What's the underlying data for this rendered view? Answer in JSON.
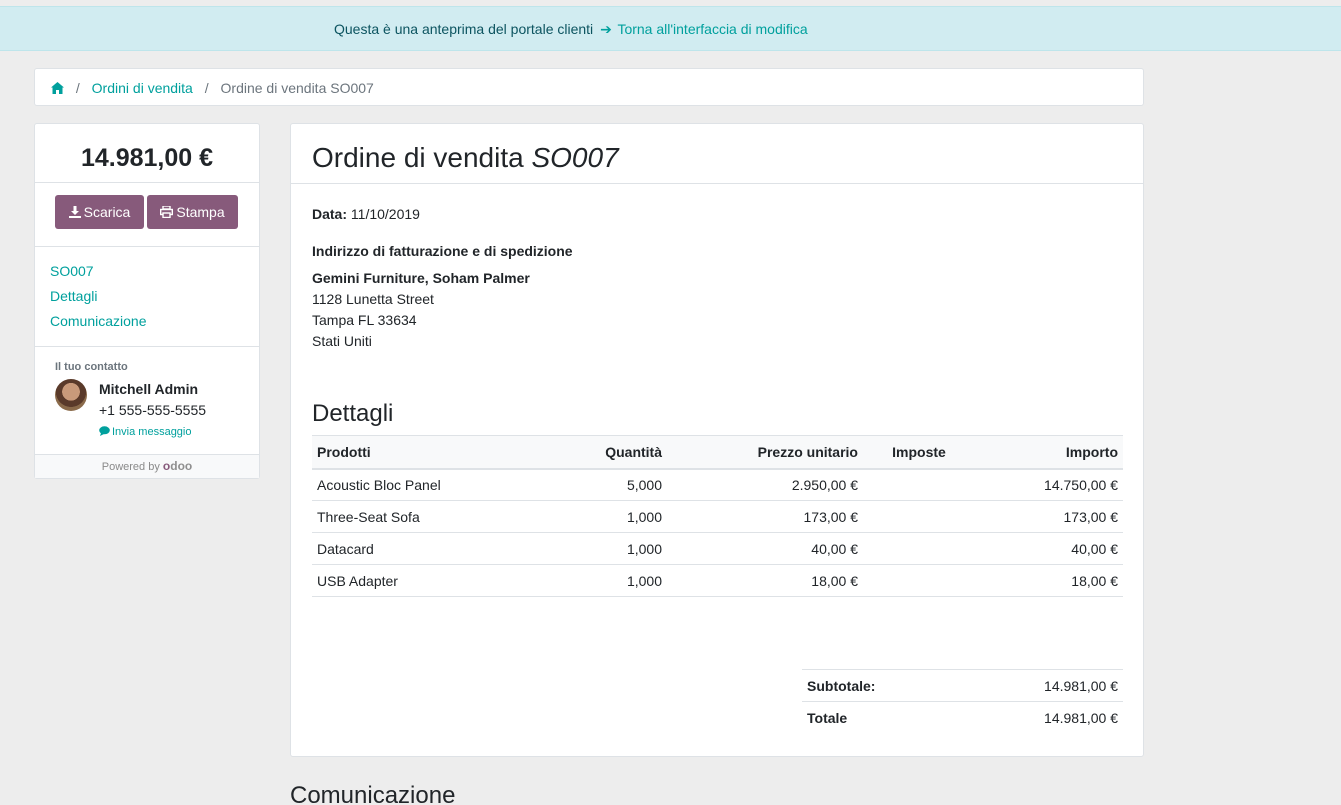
{
  "banner": {
    "text": "Questa è una anteprima del portale clienti",
    "link": "Torna all'interfaccia di modifica"
  },
  "breadcrumb": {
    "home_icon": "home-icon",
    "items": [
      "Ordini di vendita",
      "Ordine di vendita SO007"
    ]
  },
  "sidebar": {
    "amount": "14.981,00 €",
    "download_label": "Scarica",
    "print_label": "Stampa",
    "nav": [
      "SO007",
      "Dettagli",
      "Comunicazione"
    ],
    "contact": {
      "label": "Il tuo contatto",
      "name": "Mitchell Admin",
      "phone": "+1 555-555-5555",
      "message": "Invia messaggio"
    },
    "powered": "Powered by",
    "odoo_logo": "odoo"
  },
  "order": {
    "title_prefix": "Ordine di vendita",
    "title_ref": "SO007",
    "date_label": "Data:",
    "date_value": "11/10/2019",
    "address_title": "Indirizzo di fatturazione e di spedizione",
    "address": {
      "name": "Gemini Furniture, Soham Palmer",
      "street": "1128 Lunetta Street",
      "city": "Tampa FL 33634",
      "country": "Stati Uniti"
    },
    "details_title": "Dettagli",
    "columns": [
      "Prodotti",
      "Quantità",
      "Prezzo unitario",
      "Imposte",
      "Importo"
    ],
    "lines": [
      {
        "product": "Acoustic Bloc Panel",
        "qty": "5,000",
        "price": "2.950,00 €",
        "taxes": "",
        "amount": "14.750,00 €"
      },
      {
        "product": "Three-Seat Sofa",
        "qty": "1,000",
        "price": "173,00 €",
        "taxes": "",
        "amount": "173,00 €"
      },
      {
        "product": "Datacard",
        "qty": "1,000",
        "price": "40,00 €",
        "taxes": "",
        "amount": "40,00 €"
      },
      {
        "product": "USB Adapter",
        "qty": "1,000",
        "price": "18,00 €",
        "taxes": "",
        "amount": "18,00 €"
      }
    ],
    "subtotal_label": "Subtotale:",
    "subtotal_value": "14.981,00 €",
    "total_label": "Totale",
    "total_value": "14.981,00 €"
  },
  "communication_title": "Comunicazione"
}
